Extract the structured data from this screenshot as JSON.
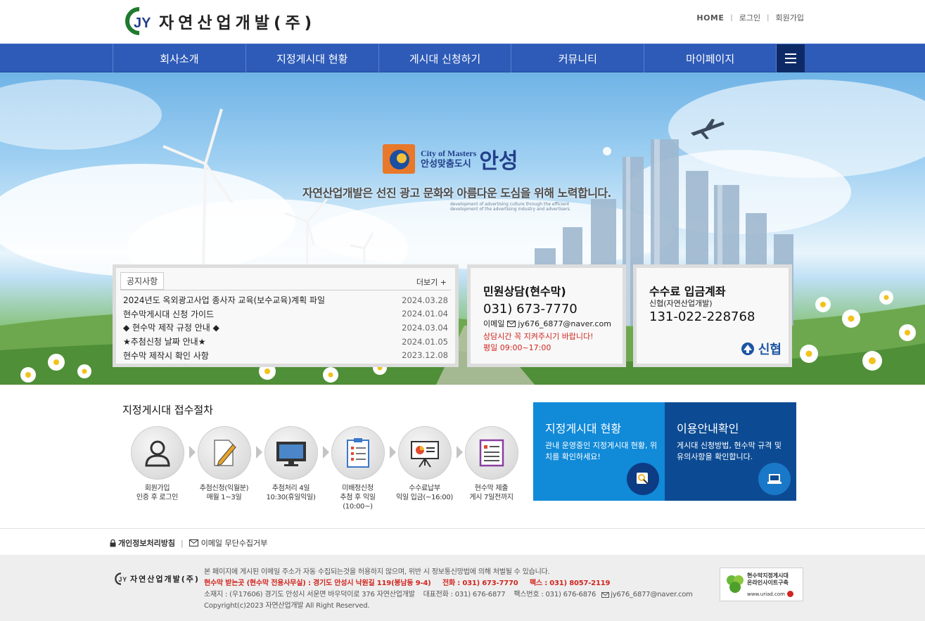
{
  "header": {
    "company": "자연산업개발(주)",
    "logo_letters": "JY",
    "links": [
      "HOME",
      "로그인",
      "회원가입"
    ]
  },
  "nav": {
    "items": [
      "회사소개",
      "지정게시대 현황",
      "게시대 신청하기",
      "커뮤니티",
      "마이페이지"
    ]
  },
  "hero": {
    "city_en": "City of Masters",
    "city_ko": "안성맞춤도시",
    "city_name": "안성",
    "slogan": "자연산업개발은 선진 광고 문화와 아름다운 도심을 위해 노력합니다.",
    "sub": "development of advertising culture through the efficient development of the advertising industry and advertisers."
  },
  "notice": {
    "tab": "공지사항",
    "more": "더보기 +",
    "items": [
      {
        "title": "2024년도 옥외광고사업 종사자 교육(보수교육)계획 파일",
        "date": "2024.03.28"
      },
      {
        "title": "현수막게시대 신청 가이드",
        "date": "2024.01.04"
      },
      {
        "title": "◆ 현수막 제작 규정 안내 ◆",
        "date": "2024.03.04"
      },
      {
        "title": "★추첨신청 날짜 안내★",
        "date": "2024.01.05"
      },
      {
        "title": "현수막 제작시 확인 사항",
        "date": "2023.12.08"
      }
    ]
  },
  "civil": {
    "title": "민원상담(현수막)",
    "phone": "031) 673-7770",
    "email_label": "이메일",
    "email": "jy676_6877@naver.com",
    "warning": "상담시간 꼭 지켜주시기 바랍니다!",
    "hours": "평일 09:00~17:00"
  },
  "fee": {
    "title": "수수료 입금계좌",
    "bank": "신협(자연산업개발)",
    "account": "131-022-228768",
    "bank_logo": "신협"
  },
  "process": {
    "title": "지정게시대 접수절차",
    "steps": [
      {
        "icon": "user-icon",
        "line1": "회원가입",
        "line2": "인증 후 로그인",
        "line3": ""
      },
      {
        "icon": "pencil-icon",
        "line1": "추첨신청(익월분)",
        "line2": "매월 1~3일",
        "line3": ""
      },
      {
        "icon": "monitor-icon",
        "line1": "추첨처리 4일",
        "line2": "10:30(휴일익일)",
        "line3": ""
      },
      {
        "icon": "clipboard-icon",
        "line1": "미배정신청",
        "line2": "추첨 후 익일",
        "line3": "(10:00~)"
      },
      {
        "icon": "presentation-icon",
        "line1": "수수료납부",
        "line2": "익일 입금(~16:00)",
        "line3": ""
      },
      {
        "icon": "checklist-icon",
        "line1": "현수막 제출",
        "line2": "게시 7일전까지",
        "line3": ""
      }
    ]
  },
  "tiles": [
    {
      "title": "지정게시대 현황",
      "desc": "관내 운영중인 지정게시대 현황, 위치를 확인하세요!"
    },
    {
      "title": "이용안내확인",
      "desc": "게시대 신청방법, 현수막 규격 및 유의사항을 확인합니다."
    }
  ],
  "footer_links": {
    "privacy": "개인정보처리방침",
    "email_reject": "이메일 무단수집거부"
  },
  "footer": {
    "company": "자연산업개발(주)",
    "line1": "본 페이지에 게시된 이메일 주소가 자동 수집되는것을 허용하지 않으며, 위반 시 정보통신망법에 의해 처벌될 수 있습니다.",
    "line2": "현수막 받는곳 (현수막 전용사무실) : 경기도 안성시 낙원길 119(봉남동 9-4)     전화 : 031) 673-7770     팩스 : 031) 8057-2119",
    "line3_a": "소재지 : (우17606) 경기도 안성시 서운면 바우덕이로 376 자연산업개발    대표전화 : 031) 676-6877    팩스번호 : 031) 676-6876",
    "line3_email": "jy676_6877@naver.com",
    "line4": "Copyright(c)2023 자연산업개발 All Right Reserved.",
    "badge_title": "현수막지정게시대",
    "badge_sub": "온라인사이트구축",
    "badge_url": "www.uriad.com"
  }
}
